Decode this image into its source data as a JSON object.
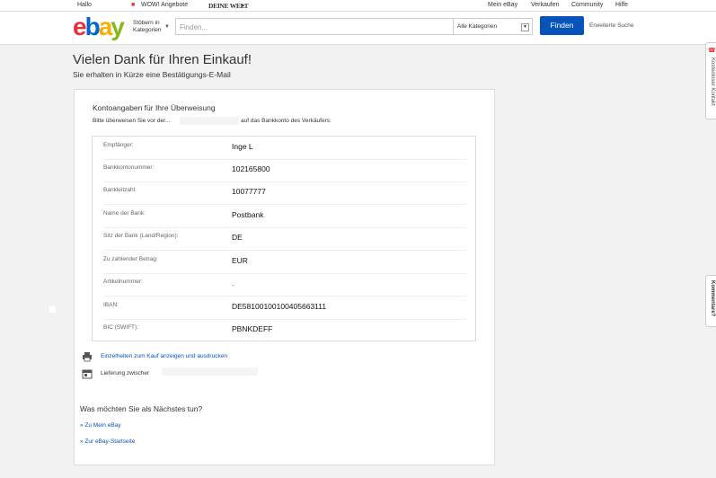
{
  "topbar": {
    "greeting": "Hallo",
    "deals": "WOW! Angebote",
    "deine_welt": "DEINE WELT",
    "my_ebay": "Mein eBay",
    "sell": "Verkaufen",
    "community": "Community",
    "help": "Hilfe"
  },
  "header": {
    "logo": {
      "e": "e",
      "b": "b",
      "a": "a",
      "y": "y"
    },
    "browse_line1": "Stöbern in",
    "browse_line2": "Kategorien",
    "search_placeholder": "Finden...",
    "category_value": "Alle Kategorien",
    "find_button": "Finden",
    "advanced_search": "Erweiterte Suche"
  },
  "page": {
    "title": "Vielen Dank für Ihren Einkauf!",
    "subtitle": "Sie erhalten in Kürze eine Bestätigungs-E-Mail"
  },
  "account": {
    "section_title": "Kontoangaben für Ihre Überweisung",
    "instruction_part1": "Bitte überweisen Sie vor der...",
    "instruction_part2": "auf das Bankkonto des Verkäufers:",
    "rows": [
      {
        "label": "Empfänger:",
        "value": "Inge L"
      },
      {
        "label": "Bankkontonummer:",
        "value": "102165800"
      },
      {
        "label": "Bankleitzahl:",
        "value": "10077777"
      },
      {
        "label": "Name der Bank:",
        "value": "Postbank"
      },
      {
        "label": "Sitz der Bank (Land/Region):",
        "value": "DE"
      },
      {
        "label": "Zu zahlender Betrag:",
        "value": "EUR"
      },
      {
        "label": "Artikelnummer:",
        "value": "."
      },
      {
        "label": "IBAN:",
        "value": "DE58100100100405663111"
      },
      {
        "label": "BIC (SWIFT):",
        "value": "PBNKDEFF"
      }
    ]
  },
  "actions": {
    "print_details": "Einzelheiten zum Kauf anzeigen und ausdrucken",
    "delivery": "Lieferung zwischer"
  },
  "next_steps": {
    "heading": "Was möchten Sie als Nächstes tun?",
    "link_my_ebay": "» Zu Mein eBay",
    "link_home": "» Zur eBay-Startseite"
  },
  "side": {
    "contact_tab": "Kostenloser Kontakt",
    "feedback_tab": "Kommentare?"
  },
  "colors": {
    "accent_blue": "#0654ba",
    "logo_red": "#e53238",
    "logo_blue": "#0064d2",
    "logo_yellow": "#f5af02",
    "logo_green": "#86b817"
  }
}
